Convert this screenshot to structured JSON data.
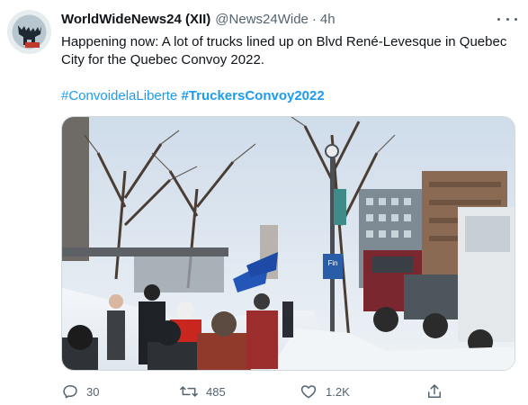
{
  "author": {
    "name": "WorldWideNews24 (XII)",
    "handle": "@News24Wide",
    "separator": "·",
    "time": "4h"
  },
  "tweet": {
    "text": "Happening now: A lot of trucks lined up on Blvd René-Levesque in Quebec City for the Quebec Convoy 2022.",
    "hashtags": [
      "#ConvoidelaLiberte",
      "#TruckersConvoy2022"
    ]
  },
  "media": {
    "sign_text": "Fin"
  },
  "actions": {
    "reply_count": "30",
    "retweet_count": "485",
    "like_count": "1.2K"
  },
  "colors": {
    "link": "#1d9bf0",
    "secondary_text": "#536471",
    "border": "#cfd9de"
  }
}
